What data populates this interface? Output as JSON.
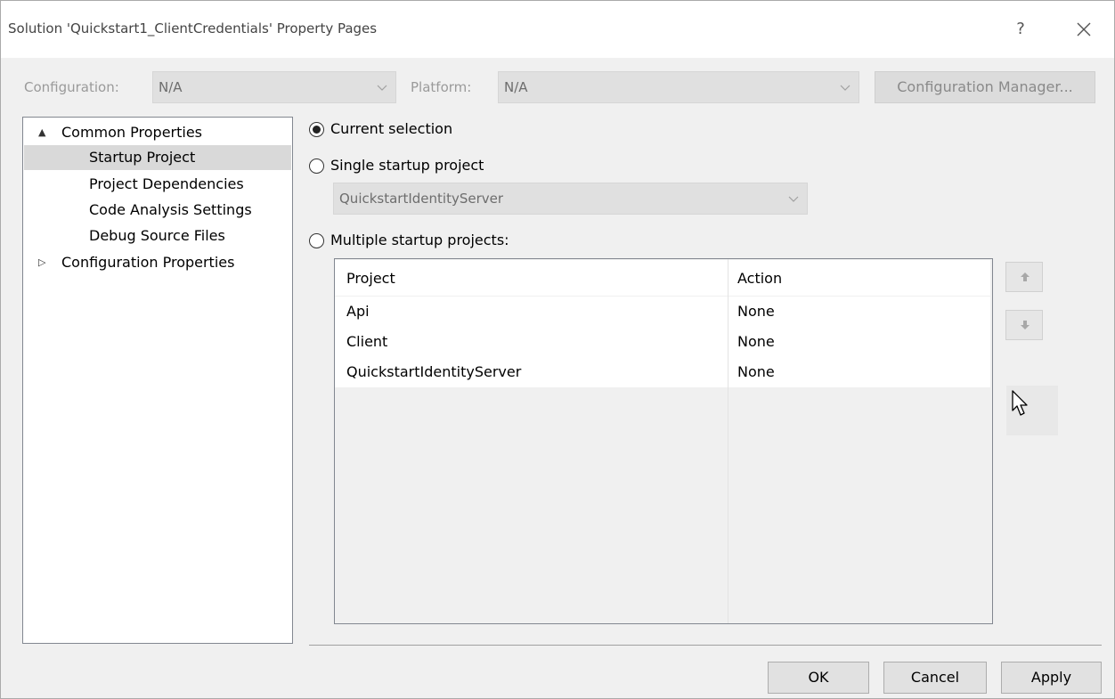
{
  "window": {
    "title": "Solution 'Quickstart1_ClientCredentials' Property Pages",
    "help_label": "?"
  },
  "config_bar": {
    "configuration_label": "Configuration:",
    "configuration_value": "N/A",
    "platform_label": "Platform:",
    "platform_value": "N/A",
    "config_manager_label": "Configuration Manager..."
  },
  "tree": {
    "items": [
      {
        "label": "Common Properties",
        "expander": "▲",
        "level": 0
      },
      {
        "label": "Startup Project",
        "level": 1,
        "selected": true
      },
      {
        "label": "Project Dependencies",
        "level": 1
      },
      {
        "label": "Code Analysis Settings",
        "level": 1
      },
      {
        "label": "Debug Source Files",
        "level": 1
      },
      {
        "label": "Configuration Properties",
        "expander": "▷",
        "level": 0
      }
    ]
  },
  "startup": {
    "current_selection_label": "Current selection",
    "single_label": "Single startup project",
    "single_value": "QuickstartIdentityServer",
    "multiple_label": "Multiple startup projects:",
    "selected_option": "current"
  },
  "grid": {
    "columns": [
      "Project",
      "Action"
    ],
    "rows": [
      [
        "Api",
        "None"
      ],
      [
        "Client",
        "None"
      ],
      [
        "QuickstartIdentityServer",
        "None"
      ]
    ]
  },
  "buttons": {
    "ok": "OK",
    "cancel": "Cancel",
    "apply": "Apply"
  },
  "icons": {
    "close": "close-icon",
    "move_up": "arrow-up-icon",
    "move_down": "arrow-down-icon",
    "cursor": "mouse-pointer-icon"
  }
}
